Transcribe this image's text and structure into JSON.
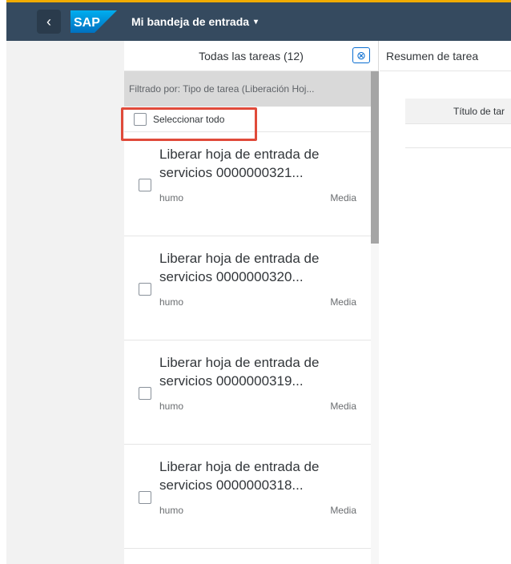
{
  "shell": {
    "back_label": "‹",
    "logo_text": "SAP",
    "title": "Mi bandeja de entrada",
    "title_caret": "▾"
  },
  "master": {
    "header_title": "Todas las tareas (12)",
    "clear_icon": "⊗",
    "filter_text": "Filtrado por: Tipo de tarea (Liberación Hoj...",
    "select_all_label": "Seleccionar todo",
    "items": [
      {
        "title": "Liberar hoja de entrada de servicios 0000000321...",
        "creator": "humo",
        "priority": "Media"
      },
      {
        "title": "Liberar hoja de entrada de servicios 0000000320...",
        "creator": "humo",
        "priority": "Media"
      },
      {
        "title": "Liberar hoja de entrada de servicios 0000000319...",
        "creator": "humo",
        "priority": "Media"
      },
      {
        "title": "Liberar hoja de entrada de servicios 0000000318...",
        "creator": "humo",
        "priority": "Media"
      }
    ]
  },
  "detail": {
    "header_title": "Resumen de tarea",
    "table_column": "Título de tar"
  },
  "colors": {
    "shell_bg": "#354a5f",
    "highlight": "#e04a3a",
    "accent": "#0a6ed1"
  }
}
